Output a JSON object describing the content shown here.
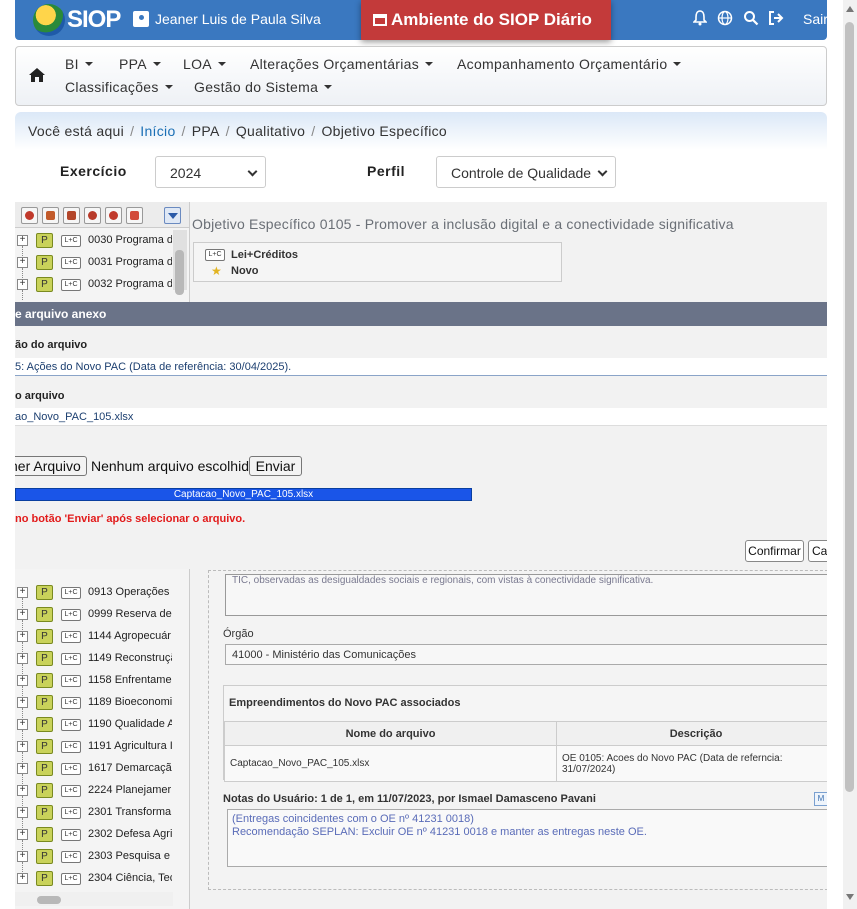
{
  "topbar": {
    "logo_text": "SIOP",
    "user_name": "Jeaner Luis de Paula Silva",
    "environment": "Ambiente do SIOP Diário",
    "logout_label": "Sair",
    "icons": [
      "bell-icon",
      "globe-icon",
      "search-icon",
      "logout-icon"
    ]
  },
  "menu": {
    "row1": [
      "BI",
      "PPA",
      "LOA",
      "Alterações Orçamentárias",
      "Acompanhamento Orçamentário"
    ],
    "row2": [
      "Classificações",
      "Gestão do Sistema"
    ]
  },
  "breadcrumb": {
    "prefix": "Você está aqui",
    "items": [
      "Início",
      "PPA",
      "Qualitativo",
      "Objetivo Específico"
    ]
  },
  "filters": {
    "exercicio_label": "Exercício",
    "exercicio_value": "2024",
    "perfil_label": "Perfil",
    "perfil_value": "Controle de Qualidade"
  },
  "tree": {
    "items_top": [
      {
        "code": "0030 Programa d"
      },
      {
        "code": "0031 Programa d"
      },
      {
        "code": "0032 Programa d"
      }
    ],
    "items_bottom": [
      {
        "code": "0913 Operações"
      },
      {
        "code": "0999 Reserva de"
      },
      {
        "code": "1144 Agropecuár"
      },
      {
        "code": "1149 Reconstruçã"
      },
      {
        "code": "1158 Enfrentame"
      },
      {
        "code": "1189 Bioeconomi"
      },
      {
        "code": "1190 Qualidade A"
      },
      {
        "code": "1191 Agricultura I"
      },
      {
        "code": "1617 Demarcaçã"
      },
      {
        "code": "2224 Planejamer"
      },
      {
        "code": "2301 Transforma"
      },
      {
        "code": "2302 Defesa Agri"
      },
      {
        "code": "2303 Pesquisa e"
      },
      {
        "code": "2304 Ciência, Tec"
      }
    ],
    "p_badge": "P",
    "lc_badge": "L+C"
  },
  "panel": {
    "title": "Objetivo Específico 0105 - Promover a inclusão digital e a conectividade significativa",
    "lei_label": "Lei+Créditos",
    "novo_label": "Novo",
    "partial_text": "TIC, observadas as desigualdades sociais e regionais, com vistas à conectividade significativa.",
    "orgao_label": "Órgão",
    "orgao_value": "41000 - Ministério das Comunicações",
    "pac": {
      "title": "Empreendimentos do Novo PAC associados",
      "columns": [
        "Nome do arquivo",
        "Descrição"
      ],
      "rows": [
        {
          "file": "Captacao_Novo_PAC_105.xlsx",
          "desc": "OE 0105: Acoes do Novo PAC (Data de referncia: 31/07/2024)"
        }
      ]
    },
    "notes_header": "Notas do Usuário: 1 de 1, em 11/07/2023, por Ismael Damasceno Pavani",
    "notes_line1": "(Entregas coincidentes com o OE nº 41231 0018)",
    "notes_line2": "Recomendação SEPLAN: Excluir OE nº 41231 0018 e manter as entregas neste OE."
  },
  "modal": {
    "title": "e arquivo anexo",
    "desc_label": "ão do arquivo",
    "desc_value": "5: Ações do Novo PAC (Data de referência: 30/04/2025).",
    "name_label": "o arquivo",
    "name_value": "ao_Novo_PAC_105.xlsx",
    "choose_label": "her Arquivo",
    "no_file_text": "Nenhum arquivo escolhido",
    "send_label": "Enviar",
    "progress_text": "Captacao_Novo_PAC_105.xlsx",
    "progress_percent": 100,
    "warning": "no botão 'Enviar' após selecionar o arquivo.",
    "confirm_label": "Confirmar",
    "cancel_label": "Cancelar"
  }
}
